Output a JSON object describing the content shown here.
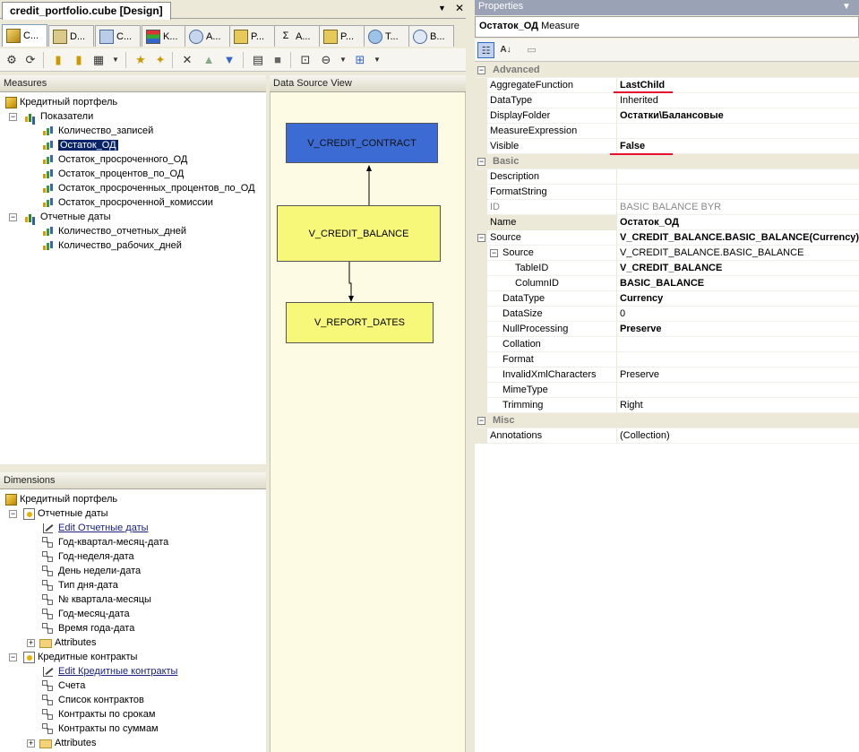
{
  "document": {
    "tab_title": "credit_portfolio.cube [Design]",
    "dropdown_icon": "triangle-down-icon",
    "close_icon": "close-icon"
  },
  "designer_tabs": [
    {
      "label": "C...",
      "icon": "cube-structure-icon",
      "active": true
    },
    {
      "label": "D...",
      "icon": "dimension-usage-icon",
      "active": false
    },
    {
      "label": "C...",
      "icon": "calculations-icon",
      "active": false
    },
    {
      "label": "K...",
      "icon": "kpi-icon",
      "active": false
    },
    {
      "label": "A...",
      "icon": "actions-icon",
      "active": false
    },
    {
      "label": "P...",
      "icon": "partitions-icon",
      "active": false
    },
    {
      "label": "A...",
      "icon": "aggregations-icon",
      "active": false
    },
    {
      "label": "P...",
      "icon": "perspectives-icon",
      "active": false
    },
    {
      "label": "T...",
      "icon": "translations-icon",
      "active": false
    },
    {
      "label": "B...",
      "icon": "browser-icon",
      "active": false
    }
  ],
  "measures_pane": {
    "title": "Measures",
    "cube": "Кредитный портфель",
    "groups": [
      {
        "name": "Показатели",
        "measures": [
          "Количество_записей",
          "Остаток_ОД",
          "Остаток_просроченного_ОД",
          "Остаток_процентов_по_ОД",
          "Остаток_просроченных_процентов_по_ОД",
          "Остаток_просроченной_комиссии"
        ]
      },
      {
        "name": "Отчетные даты",
        "measures": [
          "Количество_отчетных_дней",
          "Количество_рабочих_дней"
        ]
      }
    ],
    "selected": "Остаток_ОД"
  },
  "dsv": {
    "title": "Data Source View",
    "tables": [
      "V_CREDIT_CONTRACT",
      "V_CREDIT_BALANCE",
      "V_REPORT_DATES"
    ]
  },
  "dimensions_pane": {
    "title": "Dimensions",
    "cube": "Кредитный портфель",
    "dims": [
      {
        "name": "Отчетные даты",
        "edit_link": "Edit Отчетные даты",
        "hierarchies": [
          "Год-квартал-месяц-дата",
          "Год-неделя-дата",
          "День недели-дата",
          "Тип дня-дата",
          "№ квартала-месяцы",
          "Год-месяц-дата",
          "Время года-дата"
        ],
        "attributes": "Attributes"
      },
      {
        "name": "Кредитные контракты",
        "edit_link": "Edit Кредитные контракты",
        "hierarchies": [
          "Счета",
          "Список контрактов",
          "Контракты по срокам",
          "Контракты по суммам"
        ],
        "attributes": "Attributes"
      }
    ]
  },
  "properties": {
    "title": "Properties",
    "object_name": "Остаток_ОД",
    "object_type": "Measure",
    "categories": [
      {
        "name": "Advanced",
        "rows": [
          {
            "name": "AggregateFunction",
            "value": "LastChild",
            "bold": true
          },
          {
            "name": "DataType",
            "value": "Inherited",
            "bold": false
          },
          {
            "name": "DisplayFolder",
            "value": "Остатки\\Балансовые",
            "bold": true
          },
          {
            "name": "MeasureExpression",
            "value": "",
            "bold": false
          },
          {
            "name": "Visible",
            "value": "False",
            "bold": true
          }
        ]
      },
      {
        "name": "Basic",
        "rows": [
          {
            "name": "Description",
            "value": "",
            "bold": false
          },
          {
            "name": "FormatString",
            "value": "",
            "bold": false
          },
          {
            "name": "ID",
            "value": "BASIC BALANCE BYR",
            "bold": false,
            "gray": true
          },
          {
            "name": "Name",
            "value": "Остаток_ОД",
            "bold": true
          },
          {
            "name": "Source",
            "value": "V_CREDIT_BALANCE.BASIC_BALANCE(Currency)",
            "bold": true
          },
          {
            "name": "Source",
            "value": "V_CREDIT_BALANCE.BASIC_BALANCE",
            "bold": false
          },
          {
            "name": "TableID",
            "value": "V_CREDIT_BALANCE",
            "bold": true
          },
          {
            "name": "ColumnID",
            "value": "BASIC_BALANCE",
            "bold": true
          },
          {
            "name": "DataType",
            "value": "Currency",
            "bold": true
          },
          {
            "name": "DataSize",
            "value": "0",
            "bold": false
          },
          {
            "name": "NullProcessing",
            "value": "Preserve",
            "bold": true
          },
          {
            "name": "Collation",
            "value": "",
            "bold": false
          },
          {
            "name": "Format",
            "value": "",
            "bold": false
          },
          {
            "name": "InvalidXmlCharacters",
            "value": "Preserve",
            "bold": false
          },
          {
            "name": "MimeType",
            "value": "",
            "bold": false
          },
          {
            "name": "Trimming",
            "value": "Right",
            "bold": false
          }
        ]
      },
      {
        "name": "Misc",
        "rows": [
          {
            "name": "Annotations",
            "value": "(Collection)",
            "bold": false
          }
        ]
      }
    ]
  },
  "colors": {
    "highlight_underline": "#e8112d",
    "selection": "#0a246a",
    "dsv_fact_table": "#3c6bd4",
    "dsv_dim_table": "#f7f77a"
  }
}
